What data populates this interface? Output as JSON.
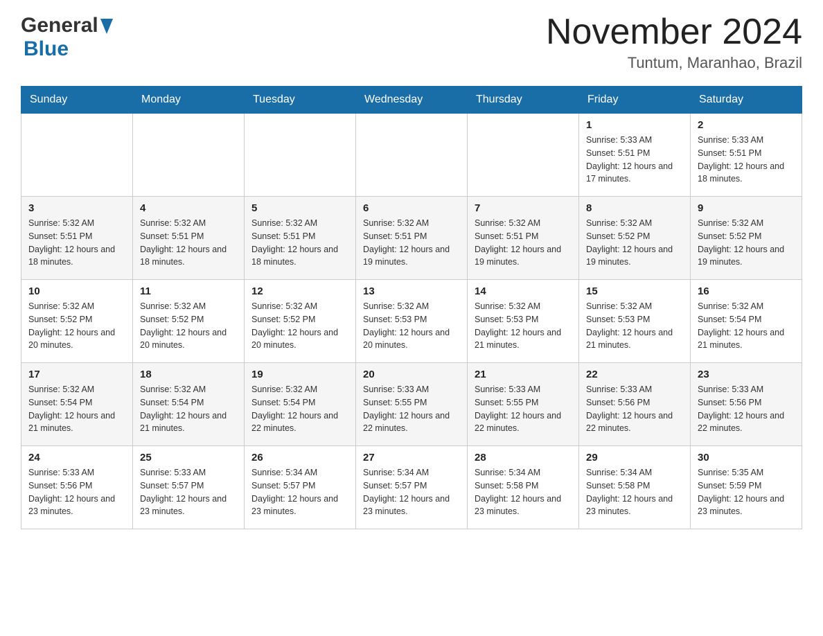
{
  "header": {
    "logo_general": "General",
    "logo_blue": "Blue",
    "month_year": "November 2024",
    "location": "Tuntum, Maranhao, Brazil"
  },
  "weekdays": [
    "Sunday",
    "Monday",
    "Tuesday",
    "Wednesday",
    "Thursday",
    "Friday",
    "Saturday"
  ],
  "weeks": [
    [
      {
        "day": "",
        "sunrise": "",
        "sunset": "",
        "daylight": ""
      },
      {
        "day": "",
        "sunrise": "",
        "sunset": "",
        "daylight": ""
      },
      {
        "day": "",
        "sunrise": "",
        "sunset": "",
        "daylight": ""
      },
      {
        "day": "",
        "sunrise": "",
        "sunset": "",
        "daylight": ""
      },
      {
        "day": "",
        "sunrise": "",
        "sunset": "",
        "daylight": ""
      },
      {
        "day": "1",
        "sunrise": "Sunrise: 5:33 AM",
        "sunset": "Sunset: 5:51 PM",
        "daylight": "Daylight: 12 hours and 17 minutes."
      },
      {
        "day": "2",
        "sunrise": "Sunrise: 5:33 AM",
        "sunset": "Sunset: 5:51 PM",
        "daylight": "Daylight: 12 hours and 18 minutes."
      }
    ],
    [
      {
        "day": "3",
        "sunrise": "Sunrise: 5:32 AM",
        "sunset": "Sunset: 5:51 PM",
        "daylight": "Daylight: 12 hours and 18 minutes."
      },
      {
        "day": "4",
        "sunrise": "Sunrise: 5:32 AM",
        "sunset": "Sunset: 5:51 PM",
        "daylight": "Daylight: 12 hours and 18 minutes."
      },
      {
        "day": "5",
        "sunrise": "Sunrise: 5:32 AM",
        "sunset": "Sunset: 5:51 PM",
        "daylight": "Daylight: 12 hours and 18 minutes."
      },
      {
        "day": "6",
        "sunrise": "Sunrise: 5:32 AM",
        "sunset": "Sunset: 5:51 PM",
        "daylight": "Daylight: 12 hours and 19 minutes."
      },
      {
        "day": "7",
        "sunrise": "Sunrise: 5:32 AM",
        "sunset": "Sunset: 5:51 PM",
        "daylight": "Daylight: 12 hours and 19 minutes."
      },
      {
        "day": "8",
        "sunrise": "Sunrise: 5:32 AM",
        "sunset": "Sunset: 5:52 PM",
        "daylight": "Daylight: 12 hours and 19 minutes."
      },
      {
        "day": "9",
        "sunrise": "Sunrise: 5:32 AM",
        "sunset": "Sunset: 5:52 PM",
        "daylight": "Daylight: 12 hours and 19 minutes."
      }
    ],
    [
      {
        "day": "10",
        "sunrise": "Sunrise: 5:32 AM",
        "sunset": "Sunset: 5:52 PM",
        "daylight": "Daylight: 12 hours and 20 minutes."
      },
      {
        "day": "11",
        "sunrise": "Sunrise: 5:32 AM",
        "sunset": "Sunset: 5:52 PM",
        "daylight": "Daylight: 12 hours and 20 minutes."
      },
      {
        "day": "12",
        "sunrise": "Sunrise: 5:32 AM",
        "sunset": "Sunset: 5:52 PM",
        "daylight": "Daylight: 12 hours and 20 minutes."
      },
      {
        "day": "13",
        "sunrise": "Sunrise: 5:32 AM",
        "sunset": "Sunset: 5:53 PM",
        "daylight": "Daylight: 12 hours and 20 minutes."
      },
      {
        "day": "14",
        "sunrise": "Sunrise: 5:32 AM",
        "sunset": "Sunset: 5:53 PM",
        "daylight": "Daylight: 12 hours and 21 minutes."
      },
      {
        "day": "15",
        "sunrise": "Sunrise: 5:32 AM",
        "sunset": "Sunset: 5:53 PM",
        "daylight": "Daylight: 12 hours and 21 minutes."
      },
      {
        "day": "16",
        "sunrise": "Sunrise: 5:32 AM",
        "sunset": "Sunset: 5:54 PM",
        "daylight": "Daylight: 12 hours and 21 minutes."
      }
    ],
    [
      {
        "day": "17",
        "sunrise": "Sunrise: 5:32 AM",
        "sunset": "Sunset: 5:54 PM",
        "daylight": "Daylight: 12 hours and 21 minutes."
      },
      {
        "day": "18",
        "sunrise": "Sunrise: 5:32 AM",
        "sunset": "Sunset: 5:54 PM",
        "daylight": "Daylight: 12 hours and 21 minutes."
      },
      {
        "day": "19",
        "sunrise": "Sunrise: 5:32 AM",
        "sunset": "Sunset: 5:54 PM",
        "daylight": "Daylight: 12 hours and 22 minutes."
      },
      {
        "day": "20",
        "sunrise": "Sunrise: 5:33 AM",
        "sunset": "Sunset: 5:55 PM",
        "daylight": "Daylight: 12 hours and 22 minutes."
      },
      {
        "day": "21",
        "sunrise": "Sunrise: 5:33 AM",
        "sunset": "Sunset: 5:55 PM",
        "daylight": "Daylight: 12 hours and 22 minutes."
      },
      {
        "day": "22",
        "sunrise": "Sunrise: 5:33 AM",
        "sunset": "Sunset: 5:56 PM",
        "daylight": "Daylight: 12 hours and 22 minutes."
      },
      {
        "day": "23",
        "sunrise": "Sunrise: 5:33 AM",
        "sunset": "Sunset: 5:56 PM",
        "daylight": "Daylight: 12 hours and 22 minutes."
      }
    ],
    [
      {
        "day": "24",
        "sunrise": "Sunrise: 5:33 AM",
        "sunset": "Sunset: 5:56 PM",
        "daylight": "Daylight: 12 hours and 23 minutes."
      },
      {
        "day": "25",
        "sunrise": "Sunrise: 5:33 AM",
        "sunset": "Sunset: 5:57 PM",
        "daylight": "Daylight: 12 hours and 23 minutes."
      },
      {
        "day": "26",
        "sunrise": "Sunrise: 5:34 AM",
        "sunset": "Sunset: 5:57 PM",
        "daylight": "Daylight: 12 hours and 23 minutes."
      },
      {
        "day": "27",
        "sunrise": "Sunrise: 5:34 AM",
        "sunset": "Sunset: 5:57 PM",
        "daylight": "Daylight: 12 hours and 23 minutes."
      },
      {
        "day": "28",
        "sunrise": "Sunrise: 5:34 AM",
        "sunset": "Sunset: 5:58 PM",
        "daylight": "Daylight: 12 hours and 23 minutes."
      },
      {
        "day": "29",
        "sunrise": "Sunrise: 5:34 AM",
        "sunset": "Sunset: 5:58 PM",
        "daylight": "Daylight: 12 hours and 23 minutes."
      },
      {
        "day": "30",
        "sunrise": "Sunrise: 5:35 AM",
        "sunset": "Sunset: 5:59 PM",
        "daylight": "Daylight: 12 hours and 23 minutes."
      }
    ]
  ]
}
